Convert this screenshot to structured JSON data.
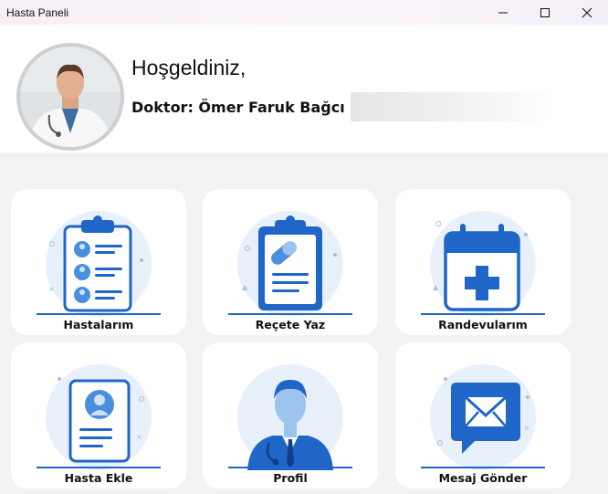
{
  "window": {
    "title": "Hasta Paneli"
  },
  "header": {
    "greeting": "Hoşgeldiniz,",
    "doctor_label": "Doktor: Ömer Faruk Bağcı"
  },
  "cards": [
    {
      "label": "Hastalarım",
      "icon": "patients-clipboard-icon"
    },
    {
      "label": "Reçete Yaz",
      "icon": "prescription-clipboard-icon"
    },
    {
      "label": "Randevularım",
      "icon": "calendar-medical-icon"
    },
    {
      "label": "Hasta Ekle",
      "icon": "patient-file-icon"
    },
    {
      "label": "Profil",
      "icon": "doctor-profile-icon"
    },
    {
      "label": "Mesaj Gönder",
      "icon": "message-envelope-icon"
    }
  ],
  "colors": {
    "accent": "#1f66c8",
    "icon_light": "#e7f0fb",
    "icon_mid": "#9cc4ef"
  }
}
